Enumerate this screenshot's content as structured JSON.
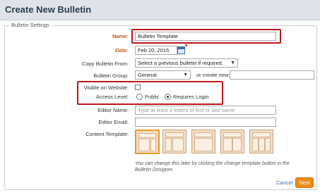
{
  "header": {
    "title": "Create New Bulletin"
  },
  "settings": {
    "legend": "Bulletin Settings",
    "name": {
      "label": "Name:",
      "value": "Bulletin Template"
    },
    "date": {
      "label": "Date:",
      "value": "Feb 20, 2015",
      "required_mark": "*"
    },
    "copy_from": {
      "label": "Copy Bulletin From:",
      "value": "Select a previous bulletin if required."
    },
    "group": {
      "label": "Bulletin Group:",
      "value": "General",
      "or_create_label": "or create new:",
      "create_value": ""
    },
    "visible": {
      "label": "Visible on Website:"
    },
    "access": {
      "label": "Access Level:",
      "options": [
        {
          "label": "Public",
          "selected": false
        },
        {
          "label": "Requires Login",
          "selected": true
        }
      ]
    },
    "editor_name": {
      "label": "Editor Name:",
      "placeholder": "Type at least 3 letters of first or last name"
    },
    "editor_email": {
      "label": "Editor Email:",
      "value": ""
    },
    "content_template": {
      "label": "Content Template:",
      "note": "You can change this later by clicking the change template button in the Bulletin Designer."
    }
  },
  "actions": {
    "cancel": "Cancel",
    "next": "Next"
  },
  "colors": {
    "highlight": "#c0141c",
    "accent": "#ec8c1c",
    "required_label": "#c15a18"
  }
}
